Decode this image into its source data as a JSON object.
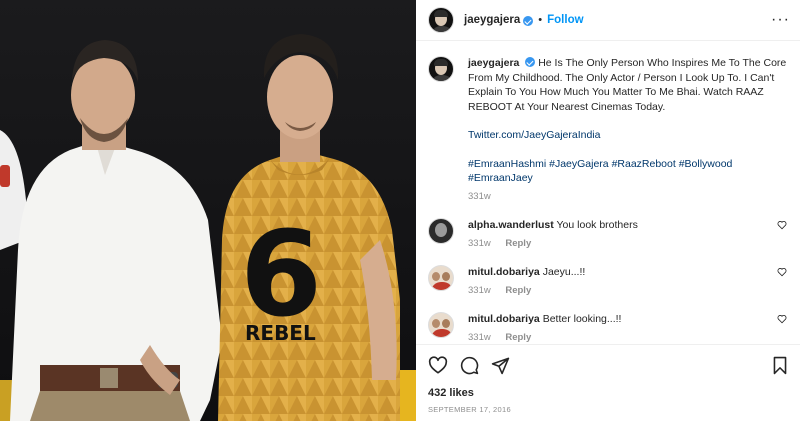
{
  "post": {
    "image_alt": "Photo of Emraan Hashmi and Jaey Gajera",
    "shirt_number": "6",
    "shirt_text": "REBEL"
  },
  "header": {
    "username": "jaeygajera",
    "separator": "•",
    "follow_label": "Follow",
    "more_label": "···"
  },
  "caption": {
    "username": "jaeygajera",
    "text": "He Is The Only Person Who Inspires Me To The Core From My Childhood. The Only Actor / Person I Look Up To. I Can't Explain To You How Much You Matter To Me Bhai. Watch RAAZ REBOOT At Your Nearest Cinemas Today.",
    "link": "Twitter.com/JaeyGajeraIndia",
    "hashtags_line1": "#EmraanHashmi #JaeyGajera #RaazReboot #Bollywood",
    "hashtags_line2": "#EmraanJaey",
    "time": "331w"
  },
  "comments": [
    {
      "username": "alpha.wanderlust",
      "text": "You look brothers",
      "time": "331w",
      "reply_label": "Reply"
    },
    {
      "username": "mitul.dobariya",
      "text": "Jaeyu...!!",
      "time": "331w",
      "reply_label": "Reply"
    },
    {
      "username": "mitul.dobariya",
      "text": "Better looking...!!",
      "time": "331w",
      "reply_label": "Reply"
    }
  ],
  "actions": {
    "likes": "432 likes",
    "date": "SEPTEMBER 17, 2016"
  },
  "colors": {
    "accent": "#0095f6",
    "link": "#00376b",
    "muted": "#8e8e8e",
    "verified": "#3897f0"
  }
}
